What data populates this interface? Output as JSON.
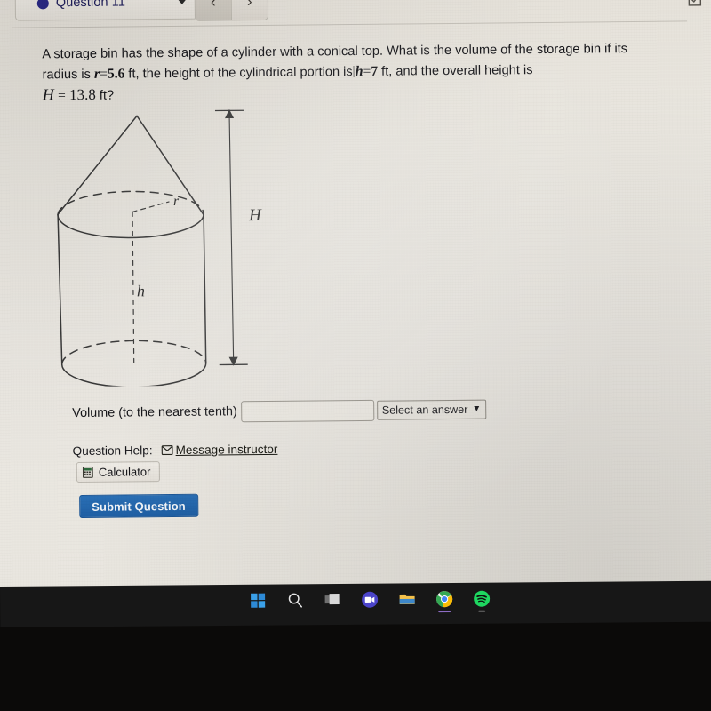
{
  "header": {
    "question_selector_label": "Question 11",
    "status_dot_color": "#2b2a86",
    "prev_label": "‹",
    "next_label": "›",
    "checkbox_icon_name": "checkbox-icon"
  },
  "question": {
    "line1_a": "A storage bin has the shape of a cylinder with a conical top. What is the volume of the storage bin if",
    "line2_a": "its radius is ",
    "var_r": "r",
    "eq1": "=",
    "val_r": "5.6",
    "unit_r": " ft, the height of the cylindrical portion is",
    "var_h": "h",
    "eq2": "=",
    "val_h": "7",
    "unit_h": " ft, and the overall height is",
    "var_H": "H",
    "eq3": "=",
    "val_H": "13.8",
    "unit_H": " ft?"
  },
  "figure": {
    "name": "cylinder-with-conical-top-diagram",
    "label_radius": "r",
    "label_height": "h",
    "label_total_height": "H"
  },
  "answer": {
    "label": "Volume (to the nearest tenth)",
    "input_value": "",
    "input_placeholder": "",
    "select_value": "Select an answer",
    "select_caret": "⌄"
  },
  "help": {
    "label": "Question Help:",
    "message_instructor": "Message instructor",
    "calculator": "Calculator"
  },
  "submit": {
    "label": "Submit Question",
    "color": "#1f5fa4"
  },
  "taskbar": {
    "items": [
      {
        "name": "windows-start-icon"
      },
      {
        "name": "search-icon"
      },
      {
        "name": "task-view-icon"
      },
      {
        "name": "teams-icon"
      },
      {
        "name": "file-explorer-icon"
      },
      {
        "name": "chrome-icon"
      },
      {
        "name": "spotify-icon"
      }
    ]
  }
}
